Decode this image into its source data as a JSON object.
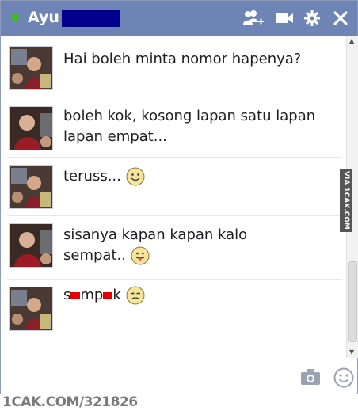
{
  "chat": {
    "contact_name": "Ayu",
    "status": "online",
    "header_icons": [
      "add-friends-icon",
      "video-call-icon",
      "gear-icon",
      "close-icon"
    ]
  },
  "messages": [
    {
      "text": "Hai boleh minta nomor hapenya?",
      "emoji": null
    },
    {
      "text": "boleh kok, kosong lapan satu lapan lapan empat...",
      "emoji": null
    },
    {
      "text": "teruss...",
      "emoji": "smile"
    },
    {
      "text": "sisanya kapan kapan kalo sempat..",
      "emoji": "tongue"
    },
    {
      "text_parts": [
        "s",
        "mp",
        "k"
      ],
      "emoji": "unamused"
    }
  ],
  "composer": {
    "icons": [
      "camera-icon",
      "emoji-icon"
    ]
  },
  "watermarks": {
    "side": "VIA 1CAK.COM",
    "footer": "1CAK.COM/321826"
  },
  "colors": {
    "titlebar": "#6d84b4",
    "online": "#42b72a",
    "redaction_blue": "#00008b",
    "redaction_red": "#e60000"
  }
}
